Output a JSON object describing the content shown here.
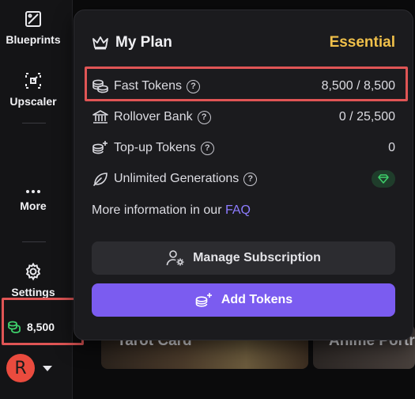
{
  "sidebar": {
    "blueprints_label": "Blueprints",
    "upscaler_label": "Upscaler",
    "more_label": "More",
    "settings_label": "Settings",
    "token_balance": "8,500",
    "avatar_initial": "R"
  },
  "background_cards": {
    "card1_label": "Tarot Card",
    "card2_label": "Anime Portr"
  },
  "plan": {
    "title": "My Plan",
    "tier": "Essential",
    "rows": [
      {
        "name": "Fast Tokens",
        "value": "8,500 / 8,500"
      },
      {
        "name": "Rollover Bank",
        "value": "0 / 25,500"
      },
      {
        "name": "Top-up Tokens",
        "value": "0"
      },
      {
        "name": "Unlimited Generations",
        "value": ""
      }
    ],
    "more_info_text": "More information in our",
    "faq_link": "FAQ",
    "manage_label": "Manage Subscription",
    "add_tokens_label": "Add Tokens"
  },
  "colors": {
    "accent_purple": "#7b5cf0",
    "tier_gold": "#f0c04a",
    "highlight_red": "#e05555",
    "avatar_red": "#ea4b3e",
    "token_green": "#3ecf6a"
  }
}
